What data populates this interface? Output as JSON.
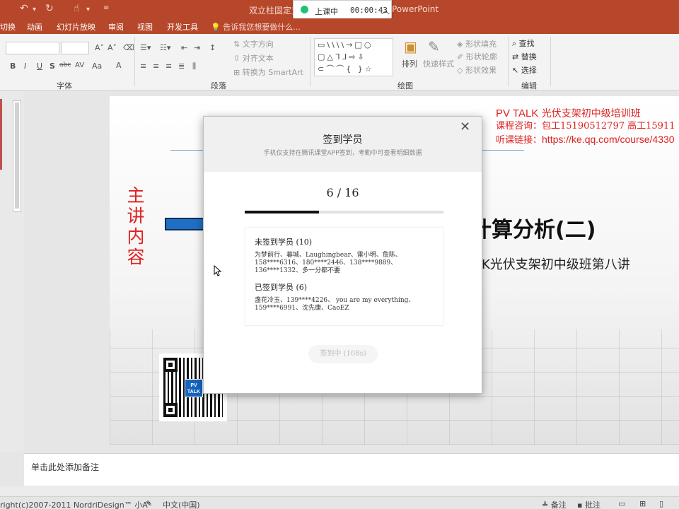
{
  "titlebar": {
    "undo_icon": "undo-icon",
    "redo_icon": "redo-icon",
    "touch_icon": "touch-mode-icon",
    "doc_title": "双立柱固定支",
    "app_name": "PowerPoint"
  },
  "timer": {
    "status": "上课中",
    "time": "00:00:43",
    "status_color": "#21c17a"
  },
  "tabs": [
    "切换",
    "动画",
    "幻灯片放映",
    "审阅",
    "视图",
    "开发工具"
  ],
  "tell_me": "告诉我您想要做什么...",
  "ribbon": {
    "groups": {
      "font": "字体",
      "paragraph": "段落",
      "drawing": "绘图",
      "editing": "编辑"
    },
    "font_buttons": [
      "B",
      "I",
      "U",
      "S",
      "abc",
      "AV",
      "Aa",
      "A"
    ],
    "text_direction": "文字方向",
    "align_text": "对齐文本",
    "convert_smartart": "转换为 SmartArt",
    "arrange": "排列",
    "quick_styles": "快速样式",
    "shape_fill": "形状填充",
    "shape_outline": "形状轮廓",
    "shape_effects": "形状效果",
    "find": "查找",
    "replace": "替换",
    "select": "选择"
  },
  "slide": {
    "pvtalk_line1_brand": "PV TALK",
    "pvtalk_line1_rest": " 光伏支架初中级培训班",
    "pvtalk_line2": "课程咨询：包工15190512797 高工15911",
    "pvtalk_line3_label": "听课链接：",
    "pvtalk_line3_url": "https://ke.qq.com/course/4330",
    "speaker_label": "主讲内容",
    "title_fragment": "计算分析(二)",
    "subtitle_fragment": "K光伏支架初中级班第八讲",
    "qr_badge_line1": "PV",
    "qr_badge_line2": "TALK"
  },
  "dialog": {
    "title": "签到学员",
    "description": "手机仅支持在腾讯课堂APP签到，考勤中可查看明细数据",
    "count_text": "6 / 16",
    "progress": {
      "signed": 6,
      "total": 16
    },
    "unsigned_header": "未签到学员 (10)",
    "unsigned_list": "为梦前行、暮城、Laughingbear、雷小明、詹陈、158****6316、180****2446、138****9889、136****1332、多一分都不要",
    "signed_header": "已签到学员 (6)",
    "signed_list": "盏花冷玉、139****4226、 you are my everything、159****6991、沈先康、CaoEZ",
    "button": "签到中 (108s)"
  },
  "notes_placeholder": "单击此处添加备注",
  "statusbar": {
    "copyright": "right(c)2007-2011 NordriDesign™ 小A”",
    "language": "中文(中国)",
    "notes": "备注",
    "comments": "批注"
  },
  "colors": {
    "brand": "#b7472a",
    "slide_red": "#e02020",
    "accent_blue": "#1f6fc4"
  }
}
